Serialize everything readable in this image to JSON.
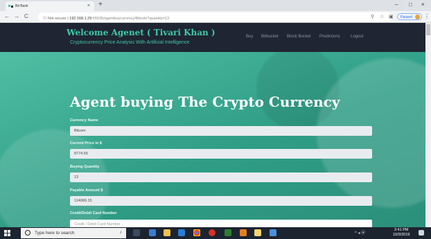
{
  "browser": {
    "tab_title": "Bit Bank",
    "tab_close": "×",
    "new_tab": "+",
    "security_label": "Not secure",
    "url_host": "192.168.1.29",
    "url_rest": ":65535/agentbuycurrency/Bitcoin?quantity=13",
    "back": "←",
    "forward": "→",
    "reload": "C",
    "info": "ⓘ",
    "paused_label": "Paused",
    "kebab": "⋮",
    "win_min": "–",
    "win_max": "□",
    "win_close": "×"
  },
  "site": {
    "title": "Welcome Agenet ( Tivari Khan )",
    "tagline": "Cryptocurrency Price Analysis With Artificial Intelligence",
    "nav": [
      "Buy",
      "Bitbucket",
      "Block Bucket",
      "Predictions",
      "Logout"
    ]
  },
  "main": {
    "heading": "Agent buying The Crypto Currency",
    "fields": [
      {
        "label": "Currency Name",
        "value": "Bitcoin"
      },
      {
        "label": "Current Price in $",
        "value": "8774.55"
      },
      {
        "label": "Buying Quantity",
        "value": "13"
      },
      {
        "label": "Payable Amount $",
        "value": "114069.15"
      },
      {
        "label": "Credit/Debit Card Number",
        "placeholder": "Credit / Debit Card Number"
      }
    ]
  },
  "taskbar": {
    "search_placeholder": "Type here to search",
    "time": "2:41 PM",
    "date": "10/3/2019",
    "tray": "^ ◂ ⦿"
  },
  "colors": {
    "accent": "#3ec9a7",
    "navbar": "#1f2532",
    "hero": "#3aa58d"
  }
}
